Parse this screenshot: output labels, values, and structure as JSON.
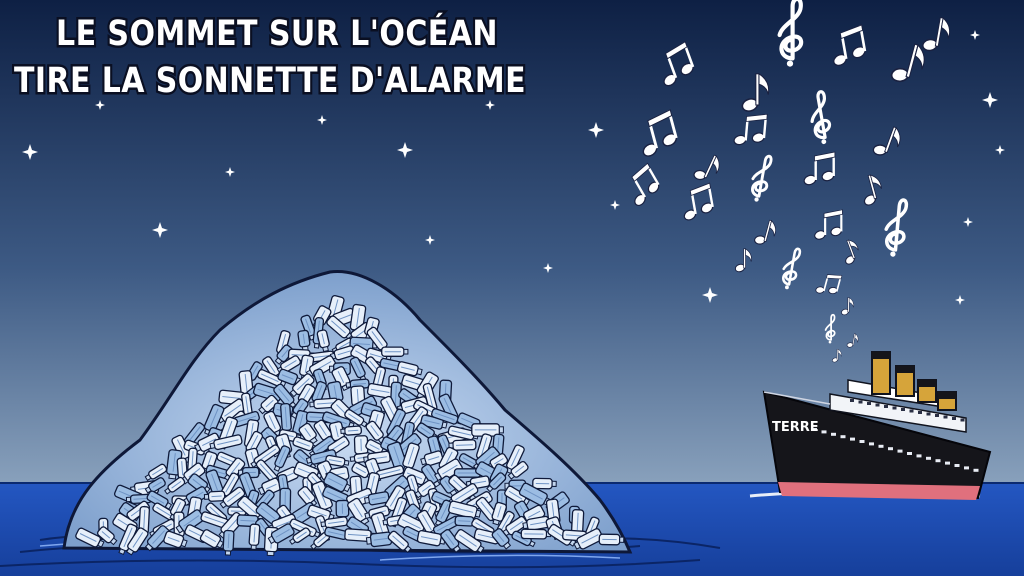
{
  "caption": {
    "line1": "LE SOMMET SUR L'OCÉAN",
    "line2": "TIRE LA SONNETTE D'ALARME"
  },
  "ship": {
    "label": "TERRE"
  },
  "icons": {
    "stars": "star-icon",
    "notes": "music-note-icon",
    "clefs": "treble-clef-icon"
  },
  "colors": {
    "sky_top": "#0e2044",
    "sky_bottom": "#8aa2bd",
    "sea": "#1d4fb7",
    "hull": "#15151a",
    "hull_waterline": "#e0707d",
    "funnel": "#d6a43a",
    "bottles": "#dfeaf8",
    "bottle_shade": "#8fb3dd"
  }
}
